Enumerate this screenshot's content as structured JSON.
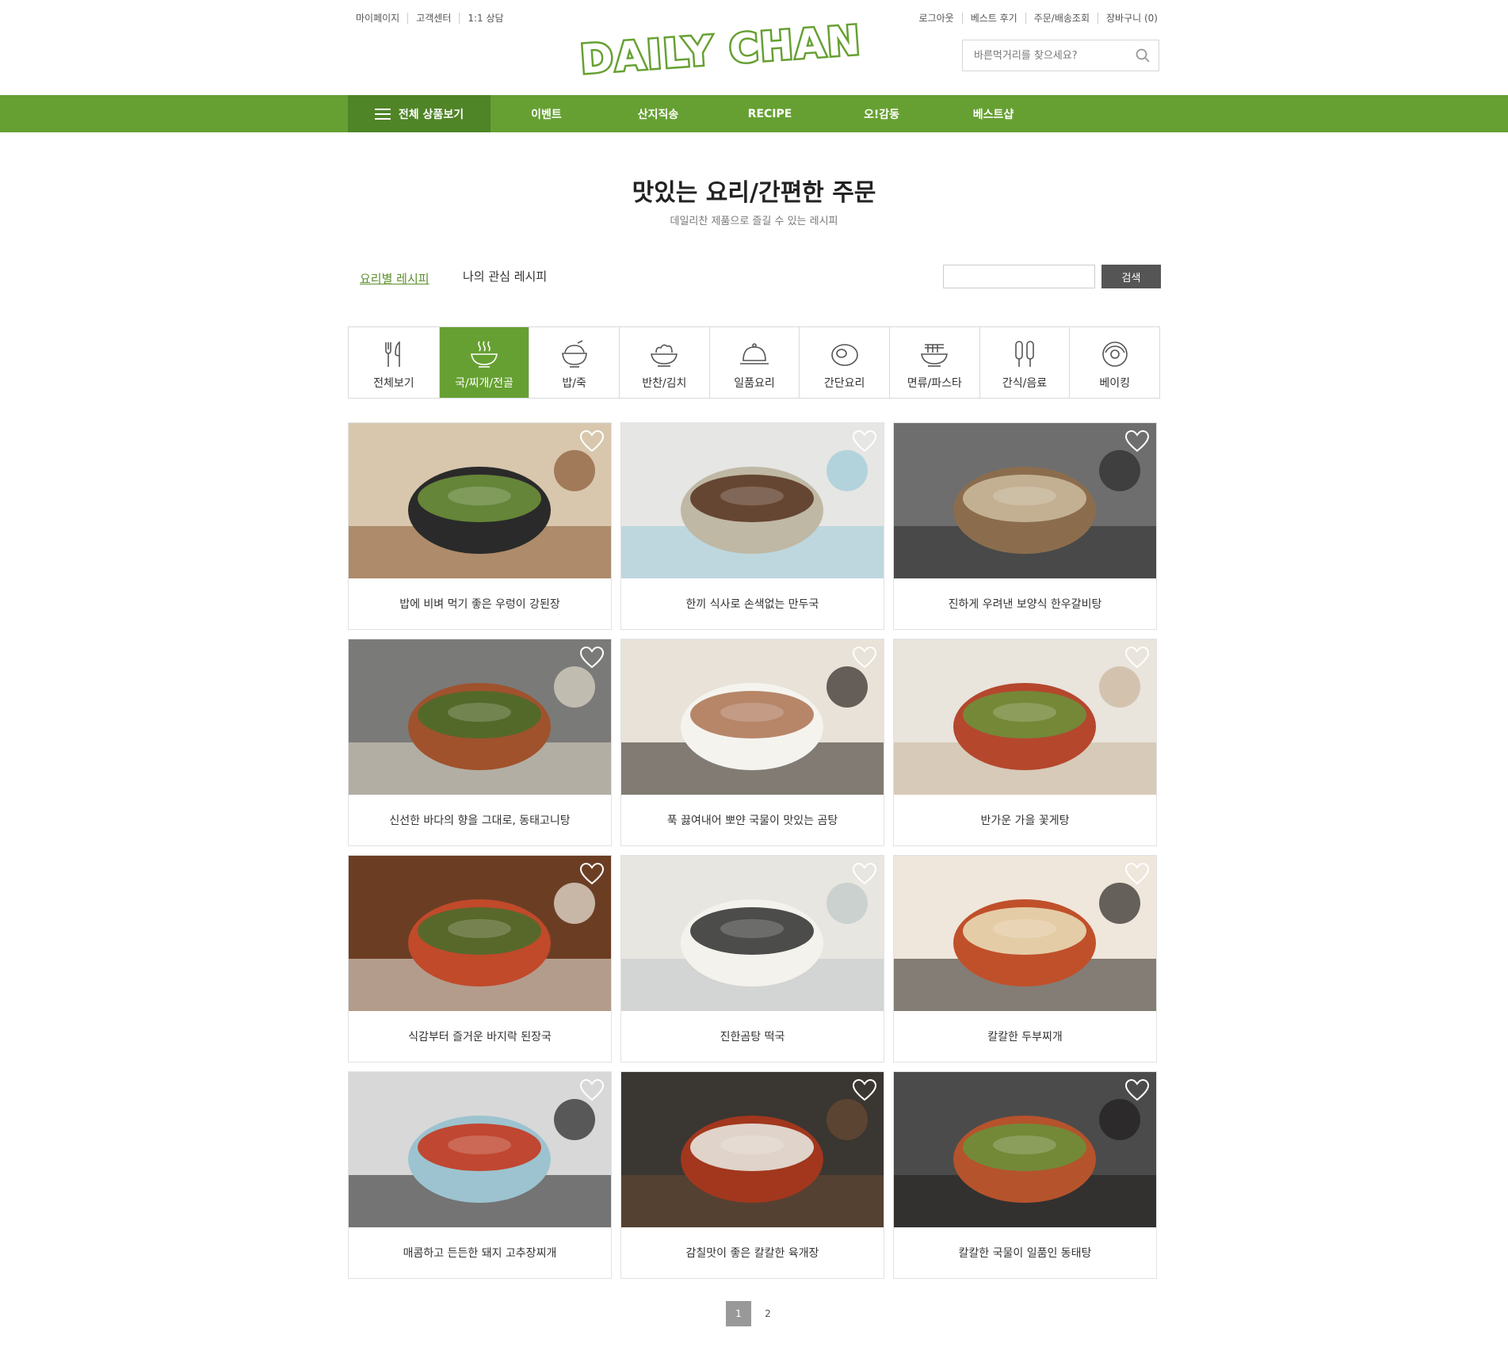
{
  "util_left": [
    "마이페이지",
    "고객센터",
    "1:1 상담"
  ],
  "util_right": [
    "로그아웃",
    "베스트 후기",
    "주문/배송조회",
    "장바구니 (0)"
  ],
  "logo": {
    "text": "DAILY CHAN",
    "color": "#66a032"
  },
  "header_search": {
    "placeholder": "바른먹거리를 찾으세요?"
  },
  "nav": {
    "all_label": "전체 상품보기",
    "items": [
      "이벤트",
      "산지직송",
      "RECIPE",
      "오!감동",
      "베스트샵"
    ]
  },
  "title": "맛있는 요리/간편한 주문",
  "subtitle": "데일리찬 제품으로 즐길 수 있는 레시피",
  "subtabs": [
    "요리별 레시피",
    "나의 관심 레시피"
  ],
  "recipe_search": {
    "button": "검색",
    "value": ""
  },
  "categories": [
    {
      "label": "전체보기",
      "icon": "utensils-icon"
    },
    {
      "label": "국/찌개/전골",
      "icon": "soup-bowl-icon",
      "active": true
    },
    {
      "label": "밥/죽",
      "icon": "rice-bowl-icon"
    },
    {
      "label": "반찬/김치",
      "icon": "side-dish-icon"
    },
    {
      "label": "일품요리",
      "icon": "cloche-icon"
    },
    {
      "label": "간단요리",
      "icon": "plate-icon"
    },
    {
      "label": "면류/파스타",
      "icon": "noodle-icon"
    },
    {
      "label": "간식/음료",
      "icon": "corndog-icon"
    },
    {
      "label": "베이킹",
      "icon": "donut-icon"
    }
  ],
  "recipes": [
    "밥에 비벼 먹기 좋은 우렁이 강된장",
    "한끼 식사로 손색없는 만두국",
    "진하게 우려낸 보양식 한우갈비탕",
    "신선한 바다의 향을 그대로, 동태고니탕",
    "푹 끓여내어 뽀얀 국물이 맛있는 곰탕",
    "반가운 가을 꽃게탕",
    "식감부터 즐거운 바지락 된장국",
    "진한곰탕 떡국",
    "칼칼한 두부찌개",
    "매콤하고 든든한 돼지 고추장찌개",
    "감칠맛이 좋은 칼칼한 육개장",
    "칼칼한 국물이 일품인 동태탕"
  ],
  "pagination": [
    "1",
    "2"
  ],
  "colors": {
    "brand_green": "#66a032",
    "nav_dark": "#4f8427"
  }
}
